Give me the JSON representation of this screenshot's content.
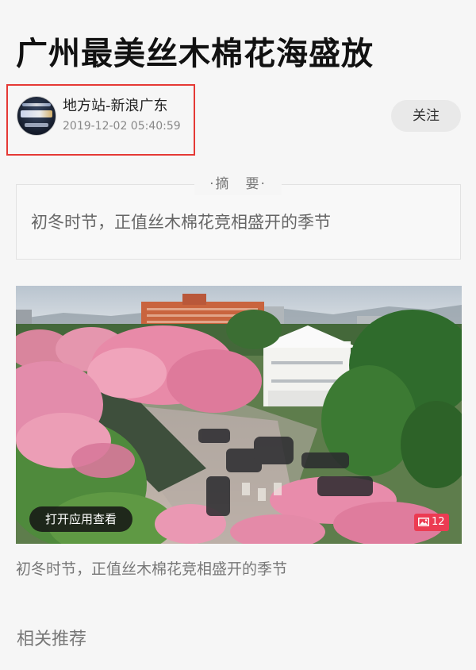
{
  "article": {
    "title": "广州最美丝木棉花海盛放",
    "author": "地方站-新浪广东",
    "published": "2019-12-02 05:40:59",
    "follow_label": "关注",
    "summary_label": "·摘　要·",
    "summary": "初冬时节，正值丝木棉花竞相盛开的季节",
    "caption": "初冬时节，正值丝木棉花竞相盛开的季节"
  },
  "photo": {
    "open_app_label": "打开应用查看",
    "image_count": "12",
    "count_icon": "image-icon"
  },
  "related": {
    "heading": "相关推荐"
  },
  "colors": {
    "highlight_border": "#e53935",
    "badge": "#ec3b52",
    "follow_bg": "#e9e9e9",
    "page_bg": "#f6f6f6"
  }
}
